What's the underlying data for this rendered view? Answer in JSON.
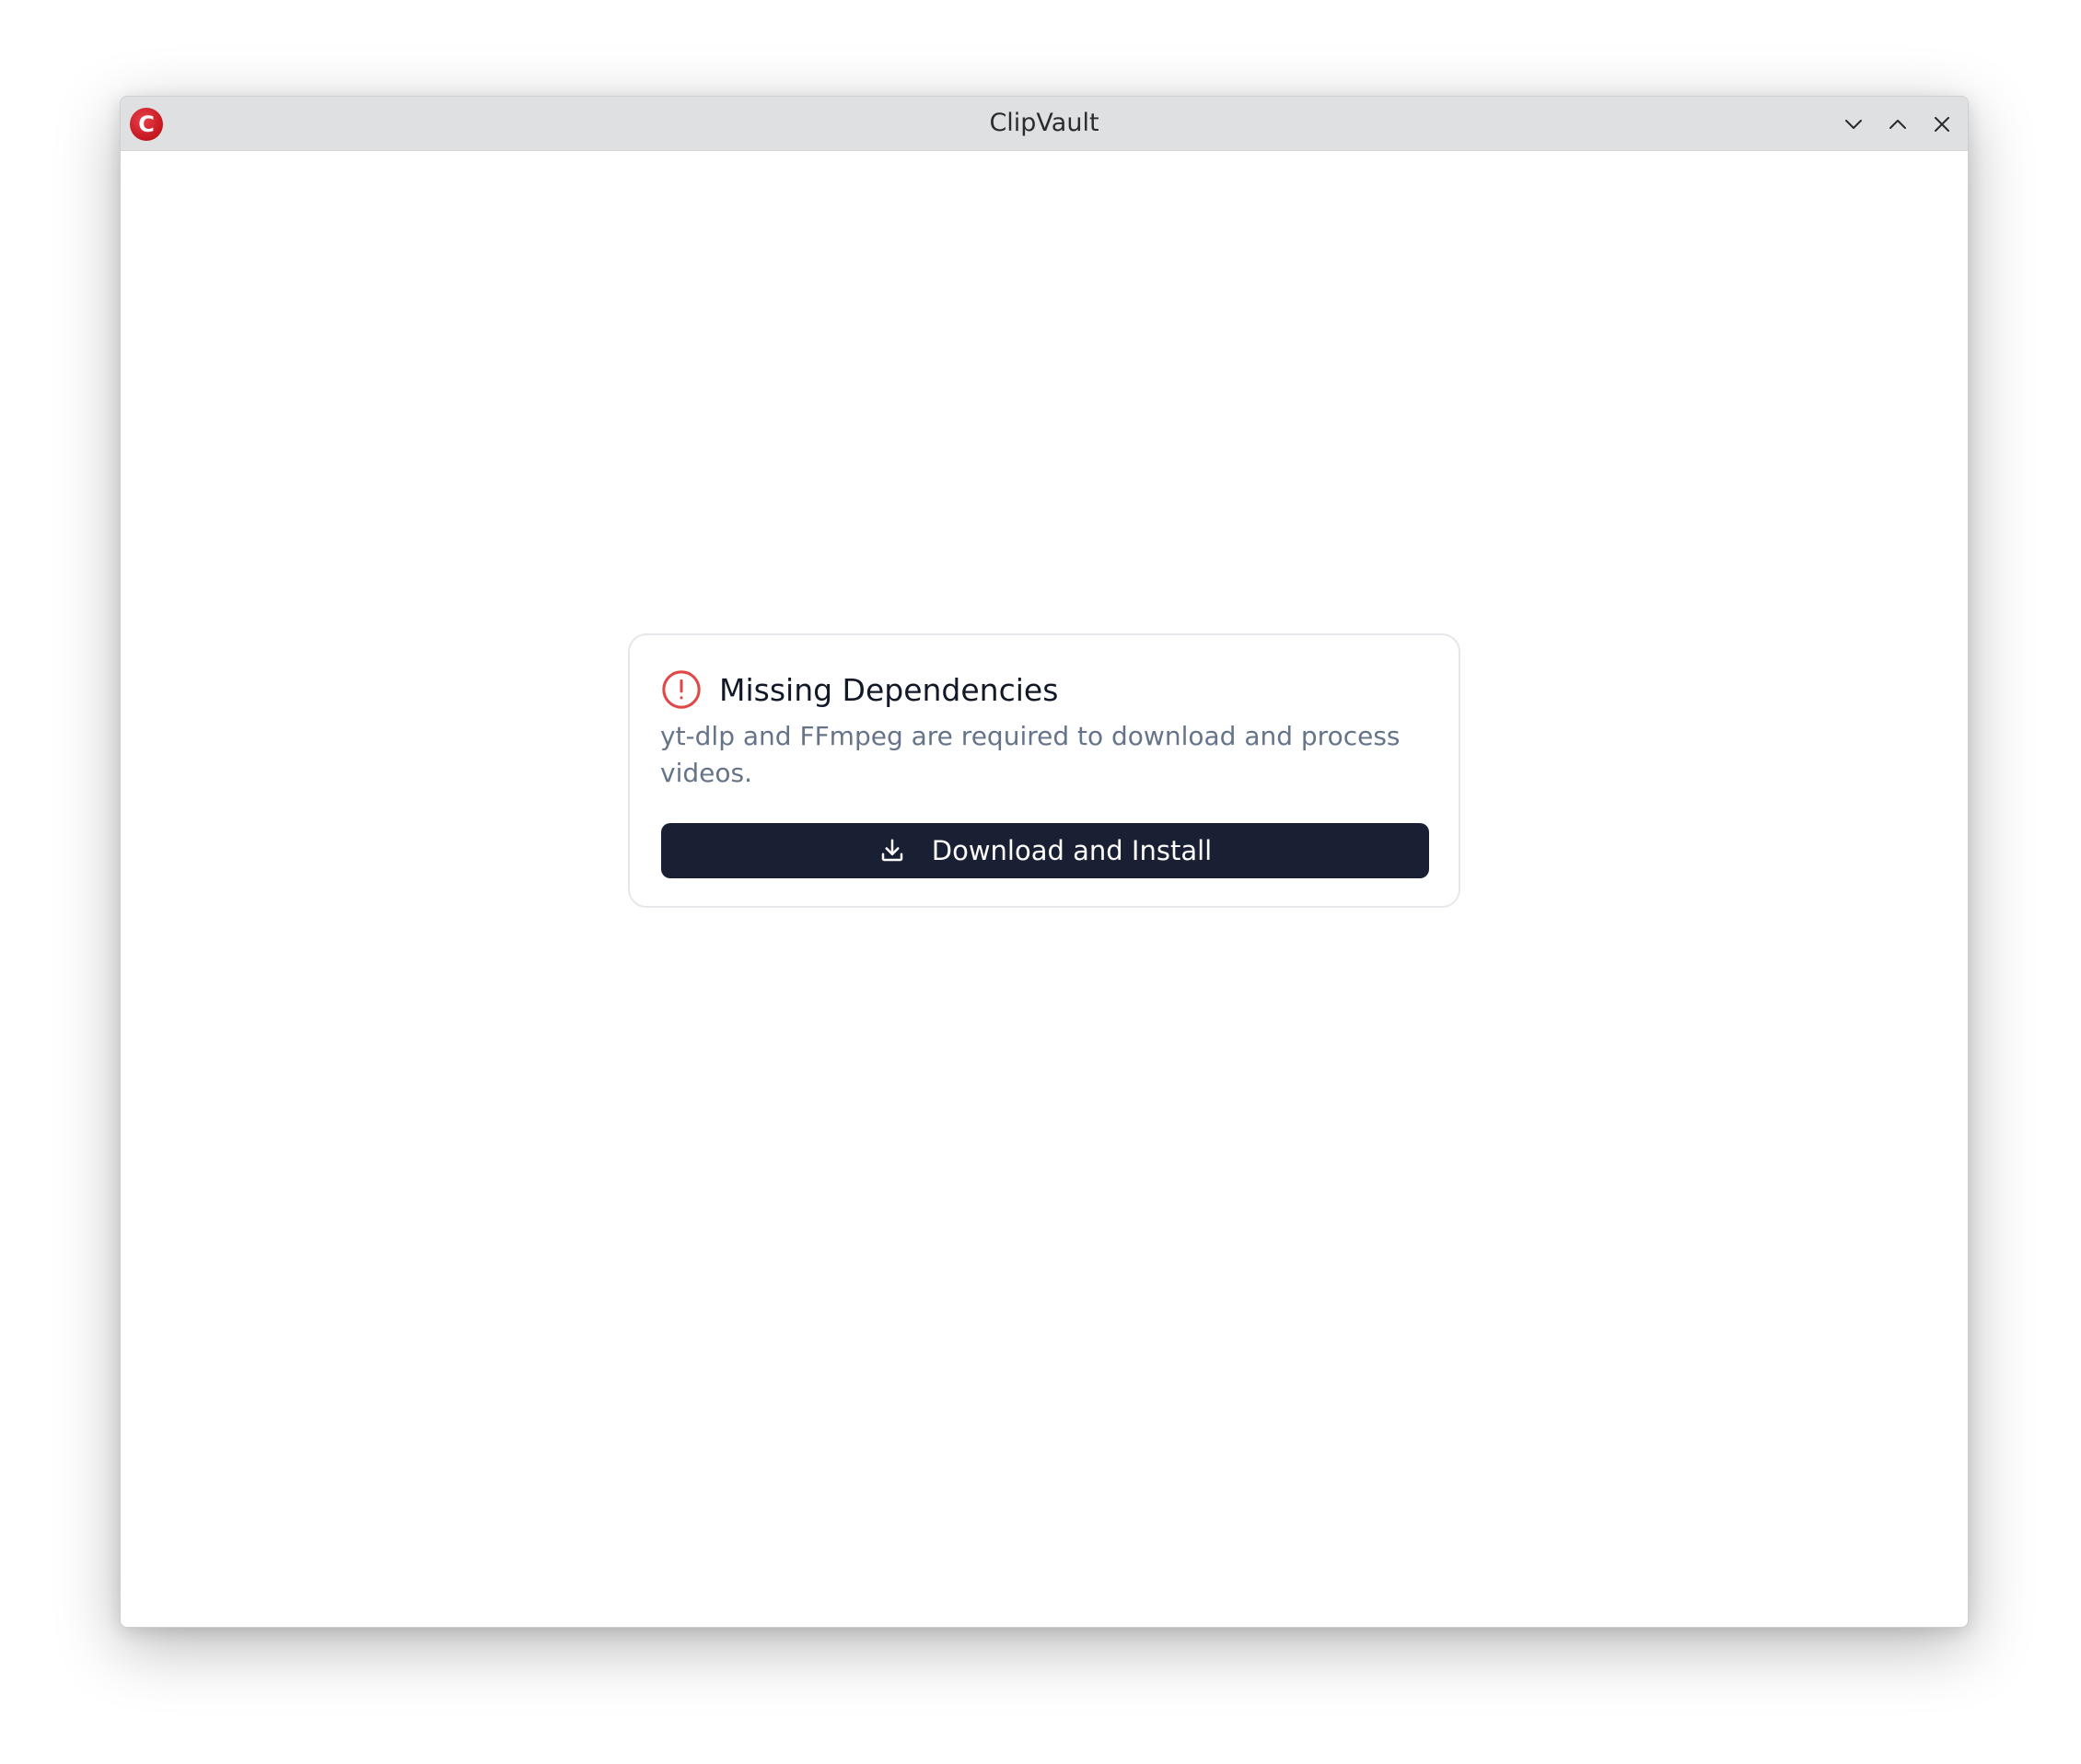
{
  "window": {
    "title": "ClipVault",
    "app_icon_letter": "C",
    "app_icon_color": "#d01c25",
    "controls": {
      "minimize_icon": "chevron-down-icon",
      "maximize_icon": "chevron-up-icon",
      "close_icon": "close-icon"
    }
  },
  "dialog": {
    "icon": "alert-circle-icon",
    "icon_color": "#e04848",
    "title": "Missing Dependencies",
    "description": "yt-dlp and FFmpeg are required to download and process videos.",
    "button": {
      "label": "Download and Install",
      "icon": "download-icon",
      "background": "#1a2033"
    }
  }
}
